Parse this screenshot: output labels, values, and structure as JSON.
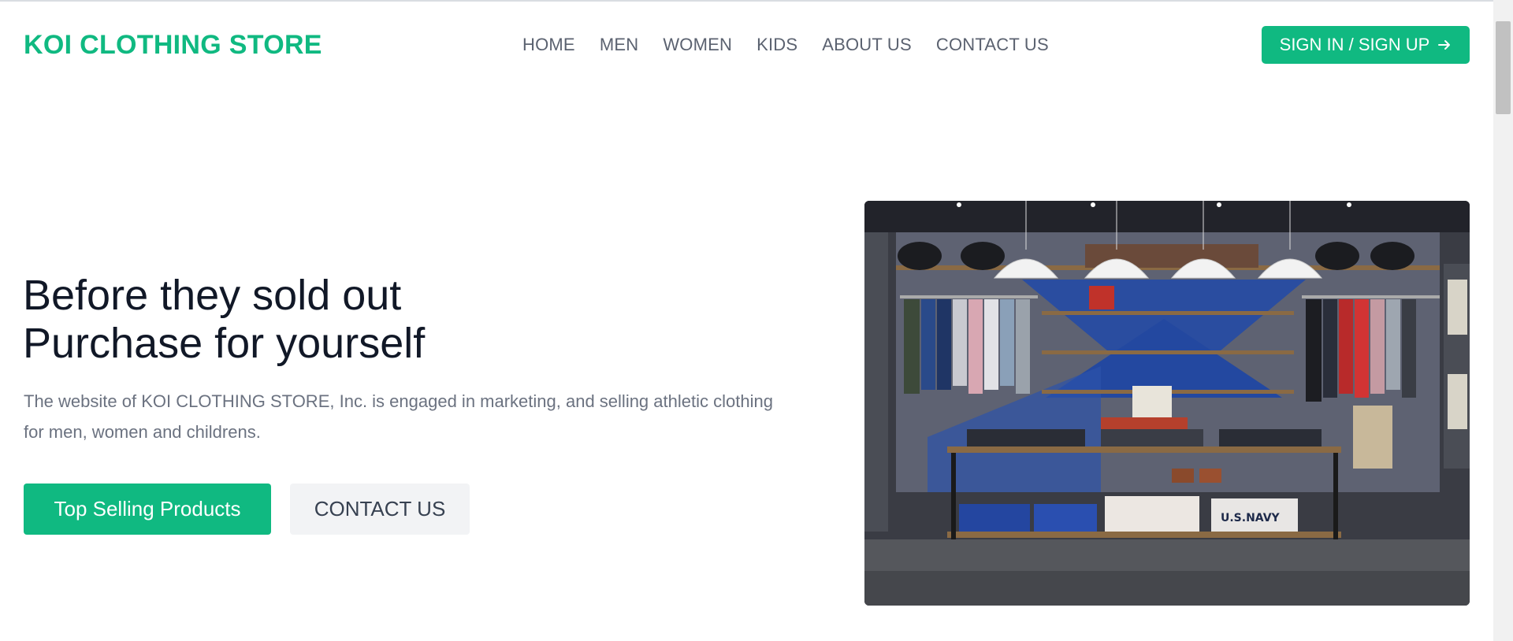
{
  "brand": {
    "logo_text": "KOI CLOTHING STORE",
    "accent_color": "#10b981"
  },
  "nav": {
    "items": [
      {
        "label": "HOME"
      },
      {
        "label": "MEN"
      },
      {
        "label": "WOMEN"
      },
      {
        "label": "KIDS"
      },
      {
        "label": "ABOUT US"
      },
      {
        "label": "CONTACT US"
      }
    ]
  },
  "auth": {
    "signin_label": "SIGN IN / SIGN UP",
    "icon": "arrow-right-icon"
  },
  "hero": {
    "headline_line1": "Before they sold out",
    "headline_line2": "Purchase for yourself",
    "description": "The website of KOI CLOTHING STORE, Inc. is engaged in marketing, and selling athletic clothing for men, women and childrens.",
    "primary_button": "Top Selling Products",
    "secondary_button": "CONTACT US",
    "image_alt": "clothing store interior",
    "image_sign_text": "U.S.NAVY"
  }
}
